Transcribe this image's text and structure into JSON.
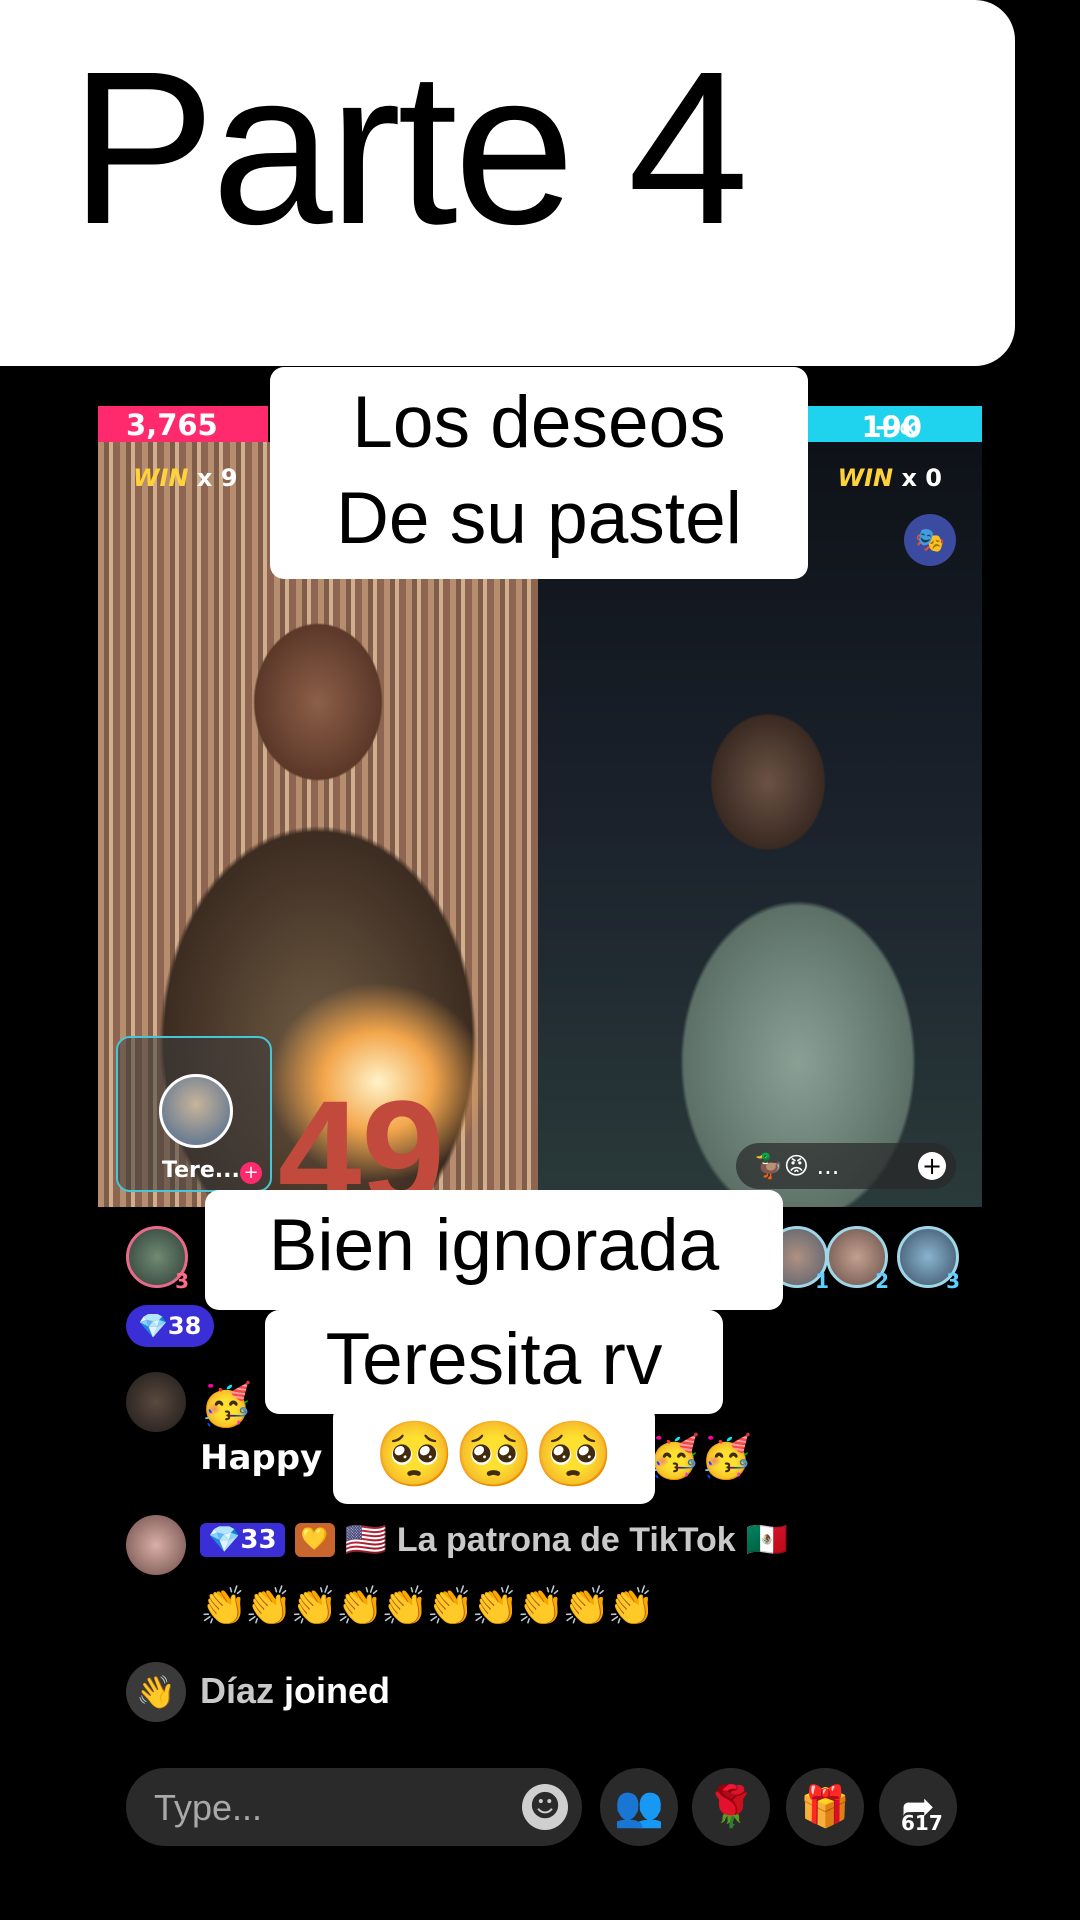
{
  "title_card": {
    "text": "Parte 4"
  },
  "battle": {
    "left_score": "3,765",
    "right_score": "190",
    "right_score_suffix": "+∞",
    "left_win": {
      "label": "WIN",
      "count": "x 9"
    },
    "right_win": {
      "label": "WIN",
      "count": "x 0"
    },
    "cake_number": "49",
    "host_name": "Tere...",
    "right_pill_text": "🦆😡 ...",
    "colors": {
      "left": "#ff2a6d",
      "right": "#1fd3ee"
    }
  },
  "captions": {
    "top_line1": "Los deseos",
    "top_line2": "De su pastel",
    "mid_line1": "Bien ignorada",
    "mid_line2": "Teresita rv",
    "mid_line3": "🥺🥺🥺"
  },
  "viewers": [
    {
      "rank": "3"
    },
    {
      "rank": "1"
    },
    {
      "rank": "2"
    },
    {
      "rank": "3"
    }
  ],
  "gem_badge": "💎38",
  "chat": [
    {
      "user": "🥳",
      "text": "Happy",
      "trail": "🥳🥳"
    },
    {
      "badge": "💎33",
      "heart": "💛",
      "flag": "🇺🇸",
      "user": "La patrona de TikTok",
      "flag2": "🇲🇽",
      "text": "👏👏👏👏👏👏👏👏👏👏"
    },
    {
      "icon": "👋",
      "user": "Díaz",
      "action": "joined"
    }
  ],
  "input": {
    "placeholder": "Type..."
  },
  "bottom_buttons": {
    "share_count": "617"
  }
}
